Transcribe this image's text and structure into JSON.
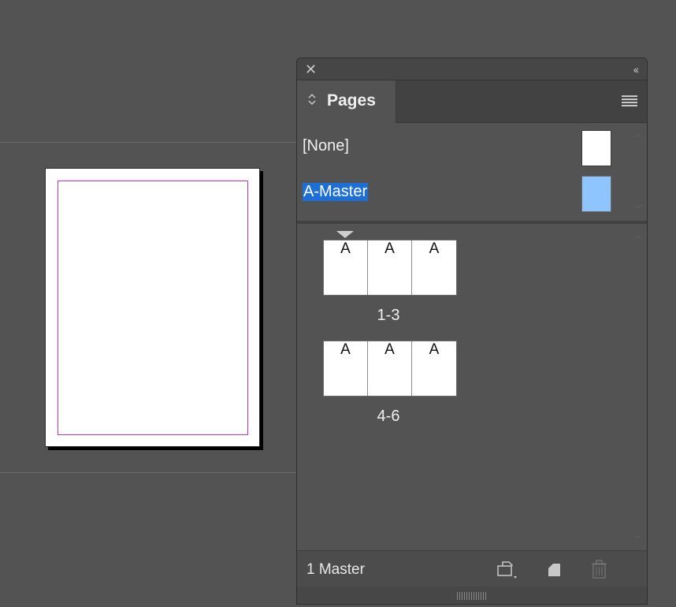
{
  "panel": {
    "close_glyph": "✕",
    "collapse_glyph": "‹‹",
    "tab_label": "Pages"
  },
  "masters": [
    {
      "label": "[None]",
      "thumb_color": "#ffffff",
      "selected": false
    },
    {
      "label": "A-Master",
      "thumb_color": "#8ec5ff",
      "selected": true
    }
  ],
  "spreads": [
    {
      "label": "1-3",
      "pages": [
        "A",
        "A",
        "A"
      ]
    },
    {
      "label": "4-6",
      "pages": [
        "A",
        "A",
        "A"
      ]
    }
  ],
  "footer": {
    "status": "1 Master",
    "icons": [
      "edit-page-size-icon",
      "new-page-icon",
      "delete-page-icon"
    ]
  },
  "colors": {
    "accent_selection": "#1c6fd6",
    "margin_guide": "#c531c5"
  }
}
